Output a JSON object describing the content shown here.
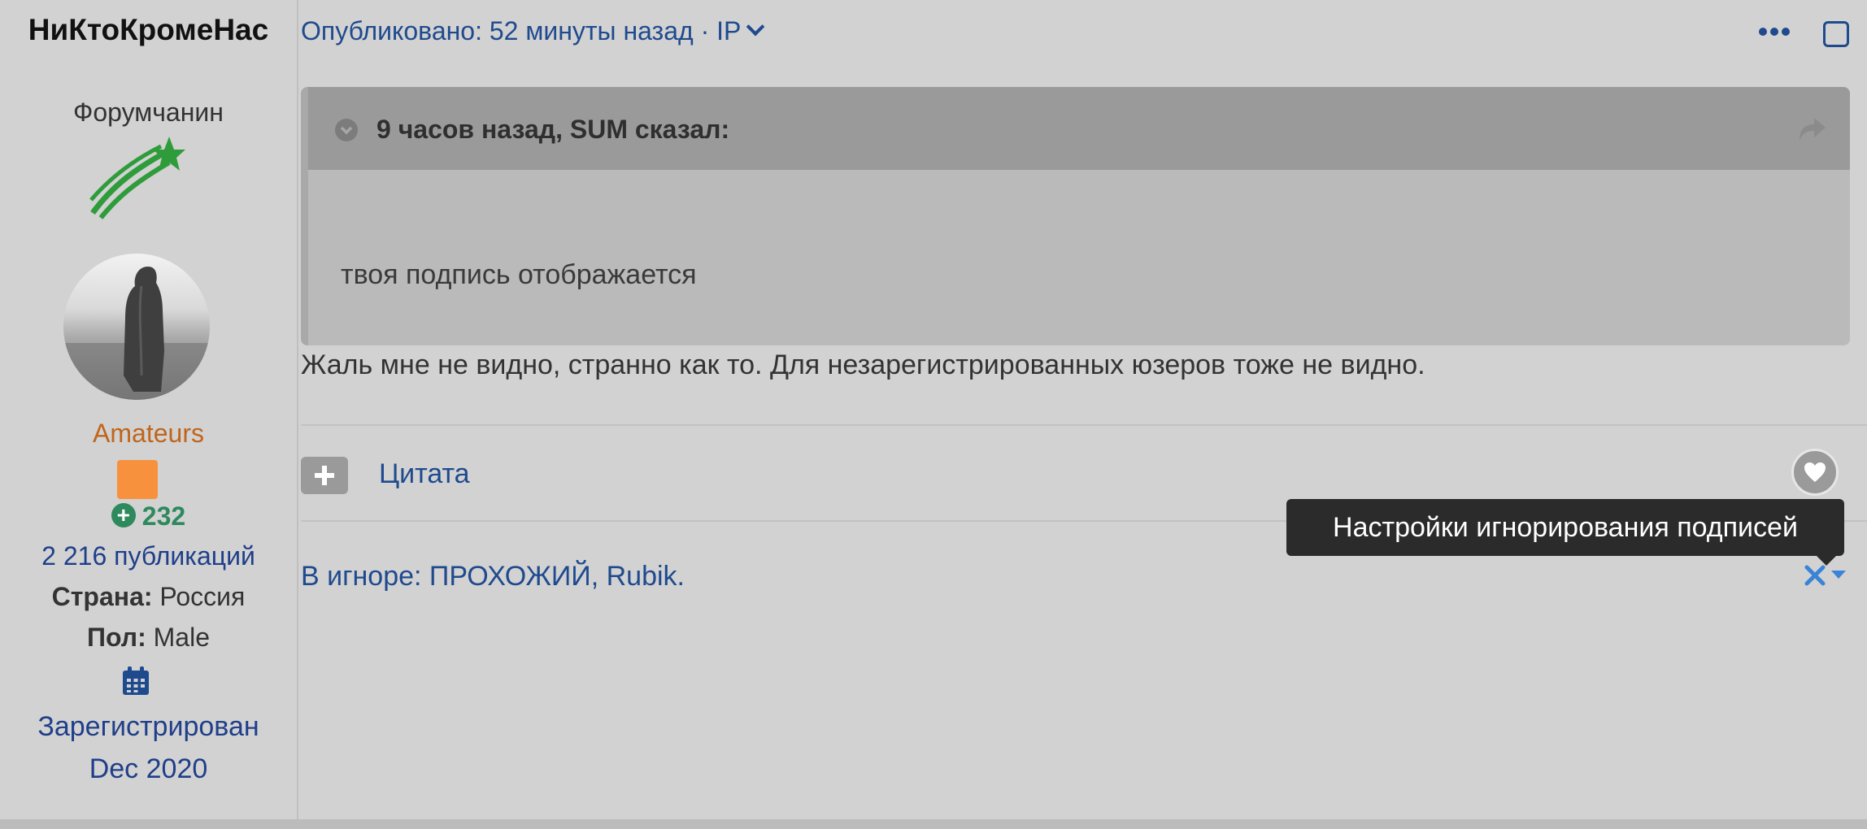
{
  "author": {
    "name": "НиКтоКромеНас",
    "title": "Форумчанин",
    "rank_icon": "shooting-star-icon",
    "group": "Amateurs",
    "group_color": "#c0651c",
    "badge_color": "#f7913d",
    "reputation": "232",
    "posts_count": "2 216 публикаций",
    "country_label": "Страна:",
    "country_value": "Россия",
    "gender_label": "Пол:",
    "gender_value": "Male",
    "joined_label": "Зарегистрирован",
    "joined_date": "Dec 2020"
  },
  "post": {
    "meta": "Опубликовано: 52 минуты назад · IP",
    "quote": {
      "citation": "9 часов назад, SUM сказал:",
      "text": "твоя подпись отображается"
    },
    "text": "Жаль мне не видно, странно как то. Для незарегистрированных юзеров тоже не видно.",
    "actions": {
      "quote_label": "Цитата"
    },
    "tooltip": "Настройки игнорирования подписей",
    "ignored": "В игнор​е: ПРОХОЖИЙ, Rubik."
  },
  "colors": {
    "link": "#1f4a8e",
    "background": "#d2d2d2",
    "reputation": "#2e8a5d",
    "tooltip_bg": "#2b2b2b"
  }
}
